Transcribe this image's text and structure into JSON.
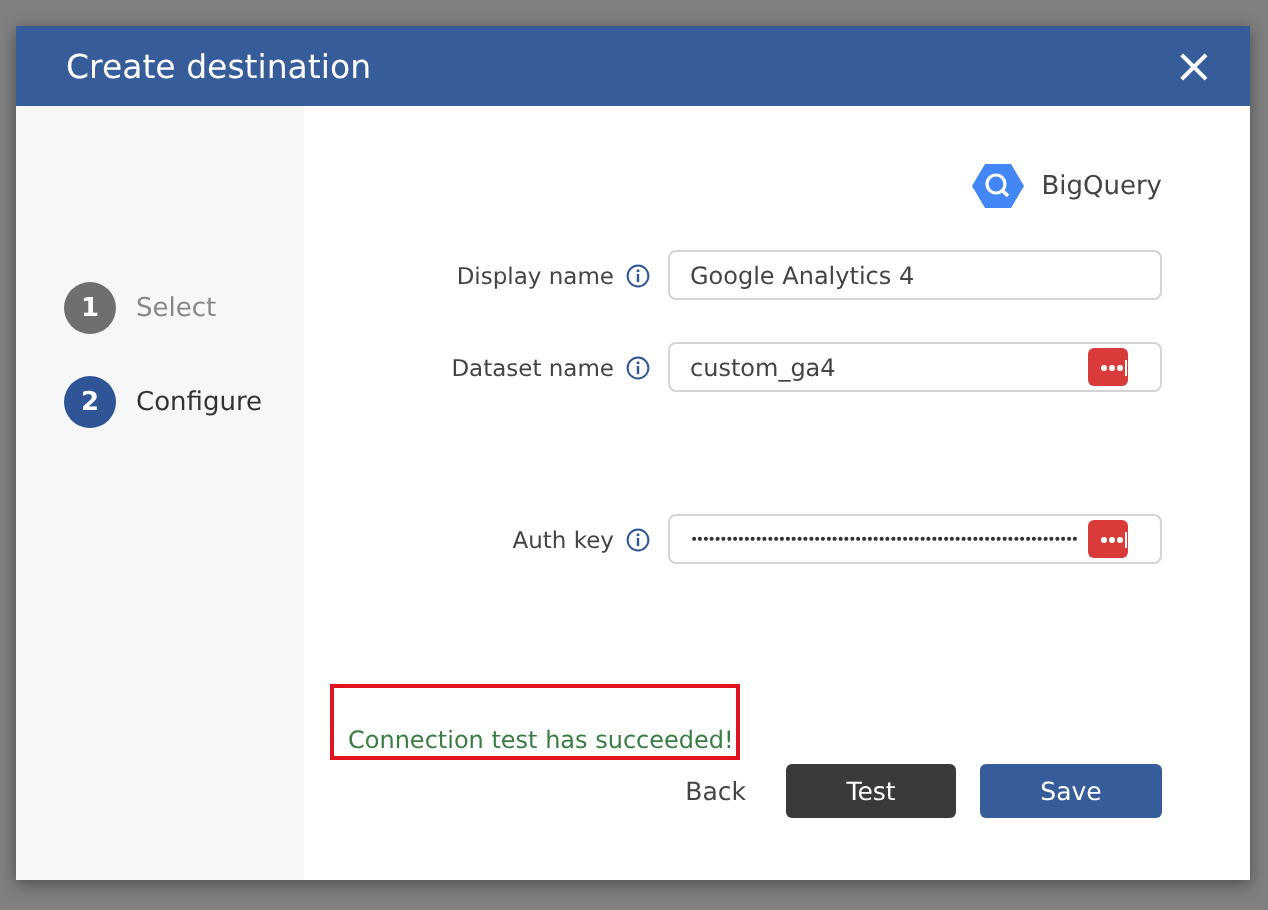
{
  "dialog": {
    "title": "Create destination",
    "close": "×"
  },
  "steps": [
    {
      "number": "1",
      "label": "Select",
      "selected": false
    },
    {
      "number": "2",
      "label": "Configure",
      "selected": true
    }
  ],
  "destination": {
    "name": "BigQuery"
  },
  "fields": [
    {
      "label": "Display name",
      "value": "Google Analytics 4",
      "kind": "text",
      "password_manager": false
    },
    {
      "label": "Dataset name",
      "value": "custom_ga4",
      "kind": "text",
      "password_manager": true
    },
    {
      "label": "Auth key",
      "value": "••••••••••••••••••••••••••••••••••••••••••••••••••••••••••••••••••",
      "kind": "secret",
      "password_manager": true
    }
  ],
  "message": {
    "text": "Connection test has succeeded!",
    "highlighted": true
  },
  "buttons": [
    {
      "label": "Back",
      "kind": "link"
    },
    {
      "label": "Test",
      "kind": "dark"
    },
    {
      "label": "Save",
      "kind": "primary"
    }
  ]
}
